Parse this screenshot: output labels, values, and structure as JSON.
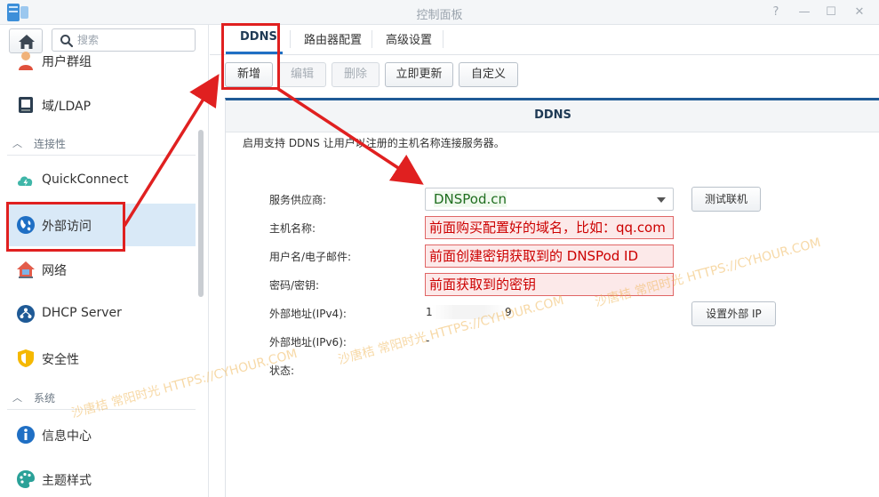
{
  "window": {
    "title": "控制面板",
    "controls": {
      "help": "?",
      "minimize": "—",
      "maximize": "☐",
      "close": "✕"
    }
  },
  "sidebar": {
    "search_placeholder": "搜索",
    "items": [
      {
        "label": "用户群组",
        "icon": "user-group-icon"
      },
      {
        "label": "域/LDAP",
        "icon": "domain-ldap-icon"
      }
    ],
    "sections": [
      {
        "label": "连接性",
        "items": [
          {
            "label": "QuickConnect",
            "icon": "quickconnect-icon"
          },
          {
            "label": "外部访问",
            "icon": "globe-icon",
            "active": true
          },
          {
            "label": "网络",
            "icon": "network-house-icon"
          },
          {
            "label": "DHCP Server",
            "icon": "dhcp-icon"
          },
          {
            "label": "安全性",
            "icon": "shield-icon"
          }
        ]
      },
      {
        "label": "系统",
        "items": [
          {
            "label": "信息中心",
            "icon": "info-icon"
          },
          {
            "label": "主题样式",
            "icon": "palette-icon"
          }
        ]
      }
    ]
  },
  "tabs": [
    {
      "label": "DDNS",
      "active": true
    },
    {
      "label": "路由器配置"
    },
    {
      "label": "高级设置"
    }
  ],
  "toolbar": {
    "add": "新增",
    "edit": "编辑",
    "delete": "删除",
    "update_now": "立即更新",
    "customize": "自定义"
  },
  "panel": {
    "title": "DDNS",
    "description": "启用支持 DDNS 让用户以注册的主机名称连接服务器。",
    "fields": {
      "provider_label": "服务供应商:",
      "provider_value": "DNSPod.cn",
      "hostname_label": "主机名称:",
      "hostname_value": "前面购买配置好的域名，比如：qq.com",
      "username_label": "用户名/电子邮件:",
      "username_value": "前面创建密钥获取到的 DNSPod ID",
      "password_label": "密码/密钥:",
      "password_value": "前面获取到的密钥",
      "ipv4_label": "外部地址(IPv4):",
      "ipv4_value_start": "1",
      "ipv4_value_end": "9",
      "ipv6_label": "外部地址(IPv6):",
      "ipv6_value": "-",
      "status_label": "状态:"
    },
    "test_connection": "测试联机",
    "set_external_ip": "设置外部 IP"
  },
  "watermarks": [
    "沙唐桔  常阳时光 HTTPS://CYHOUR.COM",
    "沙唐桔  常阳时光 HTTPS://CYHOUR.COM",
    "沙唐桔  常阳时光  HTTPS://CYHOUR.COM"
  ],
  "colors": {
    "accent": "#1f6fc4",
    "annotation_red": "#e02020",
    "active_item": "#d9e9f7"
  }
}
